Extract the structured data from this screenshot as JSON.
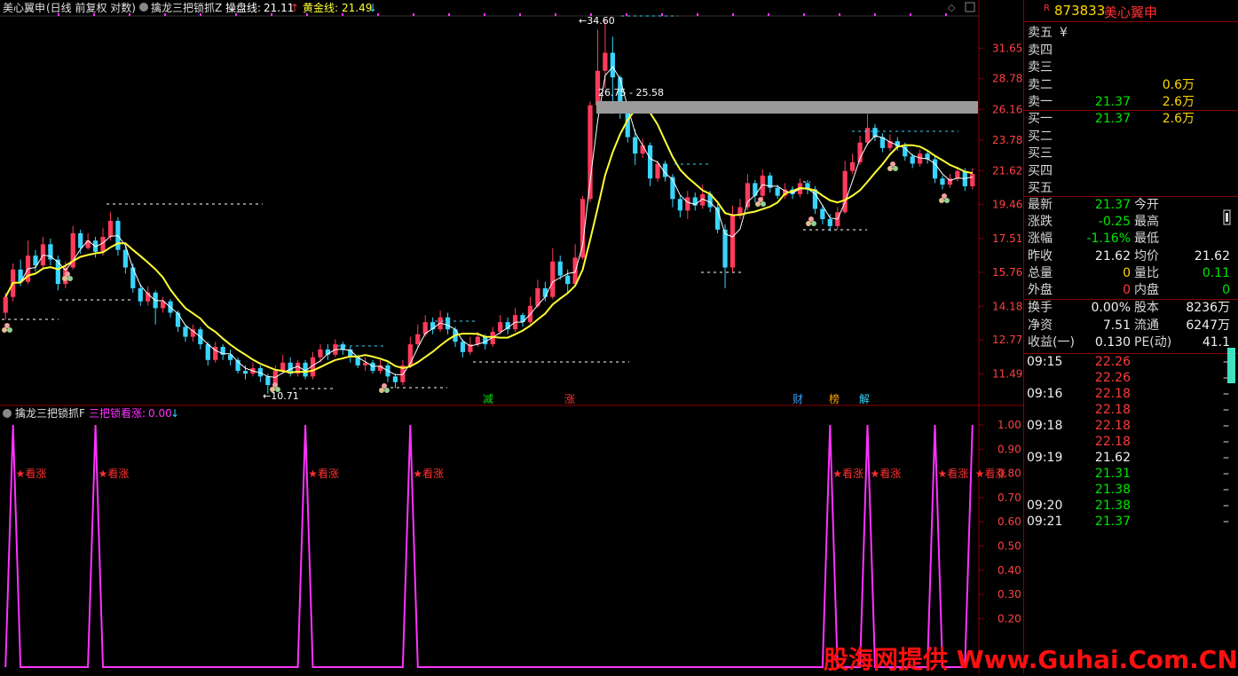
{
  "header": {
    "stock_title": "美心翼申",
    "chart_mode": "(日线 前复权 对数)",
    "indicator_name": "擒龙三把锁抓Z",
    "line1_label": "操盘线:",
    "line1_value": "21.11",
    "line1_arrow": "↑",
    "line2_label": "黄金线:",
    "line2_value": "21.49",
    "line2_arrow": "↓"
  },
  "sub_header": {
    "indicator_name": "擒龙三把锁抓F",
    "signal_label": "三把锁看涨:",
    "signal_value": "0.00",
    "signal_arrow": "↓"
  },
  "main_axis": [
    "31.65",
    "28.78",
    "26.16",
    "23.78",
    "21.62",
    "19.46",
    "17.51",
    "15.76",
    "14.18",
    "12.77",
    "11.49"
  ],
  "sub_axis": [
    "1.00",
    "0.90",
    "0.80",
    "0.70",
    "0.60",
    "0.50",
    "0.40",
    "0.30",
    "0.20"
  ],
  "annotations": {
    "high_label": "34.60",
    "low_label": "10.71",
    "box_label": "26.75 - 25.58"
  },
  "event_markers": [
    "减",
    "涨",
    "财",
    "榜",
    "解"
  ],
  "signal_text": "★看涨",
  "panel": {
    "code": "873833",
    "name": "美心翼申",
    "r_badge": "R",
    "sell": [
      {
        "label": "卖五",
        "price": "",
        "vol": "",
        "extra": "¥"
      },
      {
        "label": "卖四",
        "price": "",
        "vol": ""
      },
      {
        "label": "卖三",
        "price": "",
        "vol": ""
      },
      {
        "label": "卖二",
        "price": "",
        "vol": "0.6万"
      },
      {
        "label": "卖一",
        "price": "21.37",
        "vol": "2.6万"
      }
    ],
    "buy": [
      {
        "label": "买一",
        "price": "21.37",
        "vol": "2.6万"
      },
      {
        "label": "买二",
        "price": "",
        "vol": ""
      },
      {
        "label": "买三",
        "price": "",
        "vol": ""
      },
      {
        "label": "买四",
        "price": "",
        "vol": ""
      },
      {
        "label": "买五",
        "price": "",
        "vol": ""
      }
    ],
    "quote": [
      {
        "l1": "最新",
        "v1": "21.37",
        "c1": "green",
        "l2": "今开",
        "v2": "",
        "c2": "white"
      },
      {
        "l1": "涨跌",
        "v1": "-0.25",
        "c1": "green",
        "l2": "最高",
        "v2": "",
        "c2": "white"
      },
      {
        "l1": "涨幅",
        "v1": "-1.16%",
        "c1": "green",
        "l2": "最低",
        "v2": "",
        "c2": "white"
      },
      {
        "l1": "昨收",
        "v1": "21.62",
        "c1": "white",
        "l2": "均价",
        "v2": "21.62",
        "c2": "white"
      },
      {
        "l1": "总量",
        "v1": "0",
        "c1": "yellow",
        "l2": "量比",
        "v2": "0.11",
        "c2": "green"
      },
      {
        "l1": "外盘",
        "v1": "0",
        "c1": "red",
        "l2": "内盘",
        "v2": "0",
        "c2": "green"
      }
    ],
    "finance": [
      {
        "l1": "换手",
        "v1": "0.00%",
        "l2": "股本",
        "v2": "8236万"
      },
      {
        "l1": "净资",
        "v1": "7.51",
        "l2": "流通",
        "v2": "6247万"
      },
      {
        "l1": "收益(一)",
        "v1": "0.130",
        "l2": "PE(动)",
        "v2": "41.1"
      }
    ],
    "ticks": [
      {
        "time": "09:15",
        "price": "22.26",
        "color": "red"
      },
      {
        "time": "",
        "price": "22.26",
        "color": "red"
      },
      {
        "time": "09:16",
        "price": "22.18",
        "color": "red"
      },
      {
        "time": "",
        "price": "22.18",
        "color": "red"
      },
      {
        "time": "09:18",
        "price": "22.18",
        "color": "red"
      },
      {
        "time": "",
        "price": "22.18",
        "color": "red"
      },
      {
        "time": "09:19",
        "price": "21.62",
        "color": "white"
      },
      {
        "time": "",
        "price": "21.31",
        "color": "green"
      },
      {
        "time": "",
        "price": "21.38",
        "color": "green"
      },
      {
        "time": "09:20",
        "price": "21.38",
        "color": "green"
      },
      {
        "time": "09:21",
        "price": "21.37",
        "color": "green"
      }
    ],
    "tick_dash": "–"
  },
  "watermark": "股海网提供 Www.Guhai.Com.CN",
  "colors": {
    "up": "#ff3b5c",
    "down": "#39d5ff",
    "ma_fast": "#ffffff",
    "ma_slow": "#ffff33",
    "signal": "#ff33ff",
    "grid": "#8a0000",
    "axis_text": "#ff4040"
  },
  "chart_data": {
    "type": "candlestick",
    "y_scale": "log",
    "ylim": [
      10.71,
      34.6
    ],
    "candles": [
      [
        13.9,
        14.6,
        13.6,
        14.8
      ],
      [
        14.6,
        15.9,
        14.4,
        16.2
      ],
      [
        15.9,
        15.3,
        15.1,
        16.4
      ],
      [
        15.3,
        16.6,
        15.2,
        17.4
      ],
      [
        16.6,
        16.1,
        15.8,
        16.9
      ],
      [
        16.1,
        17.2,
        15.9,
        17.6
      ],
      [
        17.2,
        16.4,
        16.1,
        17.5
      ],
      [
        16.4,
        15.2,
        14.9,
        16.6
      ],
      [
        15.2,
        16.0,
        15.0,
        16.3
      ],
      [
        16.0,
        17.8,
        15.9,
        18.2
      ],
      [
        17.8,
        17.0,
        16.7,
        18.0
      ],
      [
        17.0,
        17.4,
        16.9,
        17.8
      ],
      [
        17.4,
        16.8,
        16.5,
        17.6
      ],
      [
        16.8,
        17.6,
        16.6,
        18.1
      ],
      [
        17.6,
        18.5,
        17.4,
        19.0
      ],
      [
        18.5,
        16.9,
        16.6,
        18.7
      ],
      [
        16.9,
        16.0,
        15.7,
        17.1
      ],
      [
        16.0,
        15.0,
        14.8,
        16.2
      ],
      [
        15.0,
        14.4,
        14.2,
        15.2
      ],
      [
        14.4,
        14.8,
        14.2,
        15.1
      ],
      [
        14.8,
        14.1,
        13.4,
        14.9
      ],
      [
        14.1,
        14.4,
        13.9,
        14.6
      ],
      [
        14.4,
        13.9,
        13.7,
        14.5
      ],
      [
        13.9,
        13.3,
        13.1,
        14.0
      ],
      [
        13.3,
        12.9,
        12.7,
        13.4
      ],
      [
        12.9,
        13.2,
        12.7,
        13.4
      ],
      [
        13.2,
        12.6,
        12.4,
        13.3
      ],
      [
        12.6,
        12.0,
        11.8,
        12.7
      ],
      [
        12.0,
        12.5,
        11.9,
        12.7
      ],
      [
        12.5,
        12.2,
        12.0,
        12.6
      ],
      [
        12.2,
        12.0,
        11.8,
        12.4
      ],
      [
        12.0,
        11.6,
        11.5,
        12.1
      ],
      [
        11.6,
        11.5,
        11.3,
        11.8
      ],
      [
        11.5,
        11.7,
        11.4,
        11.9
      ],
      [
        11.7,
        11.4,
        11.2,
        11.8
      ],
      [
        11.4,
        11.1,
        10.8,
        11.5
      ],
      [
        11.1,
        11.6,
        11.0,
        11.8
      ],
      [
        11.6,
        11.9,
        11.5,
        12.2
      ],
      [
        11.9,
        11.5,
        11.4,
        12.1
      ],
      [
        11.5,
        11.9,
        11.4,
        12.0
      ],
      [
        11.9,
        11.4,
        11.3,
        12.0
      ],
      [
        11.4,
        12.1,
        11.3,
        12.3
      ],
      [
        12.1,
        12.4,
        11.9,
        12.6
      ],
      [
        12.4,
        12.2,
        12.0,
        12.6
      ],
      [
        12.2,
        12.6,
        12.1,
        12.8
      ],
      [
        12.6,
        12.4,
        12.2,
        12.7
      ],
      [
        12.4,
        12.1,
        11.9,
        12.5
      ],
      [
        12.1,
        11.8,
        11.7,
        12.2
      ],
      [
        11.8,
        11.9,
        11.6,
        12.1
      ],
      [
        11.9,
        11.6,
        11.5,
        12.0
      ],
      [
        11.6,
        11.8,
        11.5,
        12.0
      ],
      [
        11.8,
        11.4,
        11.2,
        11.9
      ],
      [
        11.4,
        11.2,
        11.0,
        11.5
      ],
      [
        11.2,
        11.8,
        11.1,
        12.0
      ],
      [
        11.8,
        12.6,
        11.7,
        12.9
      ],
      [
        12.6,
        13.0,
        12.5,
        13.4
      ],
      [
        13.0,
        13.5,
        12.9,
        13.8
      ],
      [
        13.5,
        13.2,
        13.0,
        13.7
      ],
      [
        13.2,
        13.7,
        13.1,
        14.0
      ],
      [
        13.7,
        13.2,
        13.0,
        13.9
      ],
      [
        13.2,
        12.7,
        12.5,
        13.3
      ],
      [
        12.7,
        12.3,
        12.1,
        12.8
      ],
      [
        12.3,
        12.6,
        12.2,
        12.9
      ],
      [
        12.6,
        12.9,
        12.5,
        13.1
      ],
      [
        12.9,
        12.6,
        12.4,
        13.0
      ],
      [
        12.6,
        13.1,
        12.5,
        13.3
      ],
      [
        13.1,
        13.5,
        13.0,
        13.8
      ],
      [
        13.5,
        13.2,
        13.0,
        13.7
      ],
      [
        13.2,
        13.8,
        13.1,
        14.1
      ],
      [
        13.8,
        13.5,
        13.3,
        13.9
      ],
      [
        13.5,
        14.2,
        13.4,
        14.6
      ],
      [
        14.2,
        15.0,
        14.1,
        15.4
      ],
      [
        15.0,
        14.6,
        14.4,
        15.3
      ],
      [
        14.6,
        16.3,
        14.5,
        17.0
      ],
      [
        16.3,
        15.6,
        15.4,
        16.6
      ],
      [
        15.6,
        15.2,
        14.8,
        15.9
      ],
      [
        15.2,
        16.5,
        15.1,
        17.2
      ],
      [
        16.5,
        19.8,
        16.4,
        20.0
      ],
      [
        19.8,
        26.5,
        19.6,
        26.8
      ],
      [
        26.5,
        29.5,
        25.9,
        33.5
      ],
      [
        29.5,
        31.2,
        27.9,
        34.6
      ],
      [
        31.2,
        28.9,
        25.8,
        32.8
      ],
      [
        28.9,
        26.2,
        25.4,
        29.1
      ],
      [
        26.2,
        24.0,
        23.6,
        26.6
      ],
      [
        24.0,
        22.8,
        22.0,
        24.6
      ],
      [
        22.8,
        23.4,
        22.5,
        23.9
      ],
      [
        23.4,
        21.1,
        20.6,
        23.6
      ],
      [
        21.1,
        22.1,
        20.9,
        22.3
      ],
      [
        22.1,
        21.2,
        20.9,
        22.3
      ],
      [
        21.2,
        19.8,
        19.3,
        21.4
      ],
      [
        19.8,
        19.1,
        18.7,
        20.0
      ],
      [
        19.1,
        19.9,
        18.6,
        20.3
      ],
      [
        19.9,
        19.4,
        19.1,
        20.2
      ],
      [
        19.4,
        20.1,
        19.2,
        20.7
      ],
      [
        20.1,
        19.3,
        19.0,
        20.3
      ],
      [
        19.3,
        18.0,
        17.8,
        19.5
      ],
      [
        18.0,
        16.0,
        15.0,
        18.3
      ],
      [
        16.0,
        18.8,
        15.8,
        19.4
      ],
      [
        18.8,
        19.3,
        18.6,
        19.8
      ],
      [
        19.3,
        20.8,
        19.1,
        21.4
      ],
      [
        20.8,
        20.0,
        19.6,
        21.0
      ],
      [
        20.0,
        21.3,
        19.8,
        21.7
      ],
      [
        21.3,
        20.5,
        20.2,
        21.5
      ],
      [
        20.5,
        20.0,
        19.8,
        20.7
      ],
      [
        20.0,
        20.4,
        19.8,
        20.8
      ],
      [
        20.4,
        20.1,
        19.8,
        20.6
      ],
      [
        20.1,
        20.8,
        19.9,
        21.1
      ],
      [
        20.8,
        20.4,
        20.1,
        21.0
      ],
      [
        20.4,
        19.2,
        18.9,
        20.6
      ],
      [
        19.2,
        18.6,
        18.3,
        19.4
      ],
      [
        18.6,
        18.2,
        17.9,
        18.9
      ],
      [
        18.2,
        19.0,
        18.0,
        19.3
      ],
      [
        19.0,
        21.6,
        18.9,
        22.3
      ],
      [
        21.6,
        22.2,
        21.4,
        22.8
      ],
      [
        22.2,
        23.6,
        22.0,
        24.1
      ],
      [
        23.6,
        24.7,
        23.4,
        25.8
      ],
      [
        24.7,
        24.0,
        23.7,
        25.0
      ],
      [
        24.0,
        23.2,
        22.9,
        24.3
      ],
      [
        23.2,
        23.7,
        23.0,
        24.2
      ],
      [
        23.7,
        23.3,
        23.0,
        24.0
      ],
      [
        23.3,
        22.6,
        22.3,
        23.6
      ],
      [
        22.6,
        22.1,
        21.8,
        22.8
      ],
      [
        22.1,
        22.8,
        21.9,
        23.1
      ],
      [
        22.8,
        22.4,
        22.1,
        23.0
      ],
      [
        22.4,
        21.1,
        20.8,
        22.6
      ],
      [
        21.1,
        20.7,
        20.4,
        21.3
      ],
      [
        20.7,
        21.1,
        20.5,
        21.4
      ],
      [
        21.1,
        21.6,
        20.9,
        21.9
      ],
      [
        21.6,
        20.6,
        20.3,
        21.8
      ],
      [
        20.6,
        21.4,
        20.4,
        21.8
      ]
    ],
    "signal_values": [
      0,
      1,
      0,
      0,
      0,
      0,
      0,
      0,
      0,
      0,
      0,
      0,
      1,
      0,
      0,
      0,
      0,
      0,
      0,
      0,
      0,
      0,
      0,
      0,
      0,
      0,
      0,
      0,
      0,
      0,
      0,
      0,
      0,
      0,
      0,
      0,
      0,
      0,
      0,
      0,
      1,
      0,
      0,
      0,
      0,
      0,
      0,
      0,
      0,
      0,
      0,
      0,
      0,
      0,
      1,
      0,
      0,
      0,
      0,
      0,
      0,
      0,
      0,
      0,
      0,
      0,
      0,
      0,
      0,
      0,
      0,
      0,
      0,
      0,
      0,
      0,
      0,
      0,
      0,
      0,
      0,
      0,
      0,
      0,
      0,
      0,
      0,
      0,
      0,
      0,
      0,
      0,
      0,
      0,
      0,
      0,
      0,
      0,
      0,
      0,
      0,
      0,
      0,
      0,
      0,
      0,
      0,
      0,
      0,
      0,
      1,
      0,
      0,
      0,
      0,
      1,
      0,
      0,
      0,
      0,
      0,
      0,
      0,
      0,
      1,
      0,
      0,
      0,
      0,
      1
    ],
    "sub_ylim": [
      0,
      1.0
    ]
  }
}
